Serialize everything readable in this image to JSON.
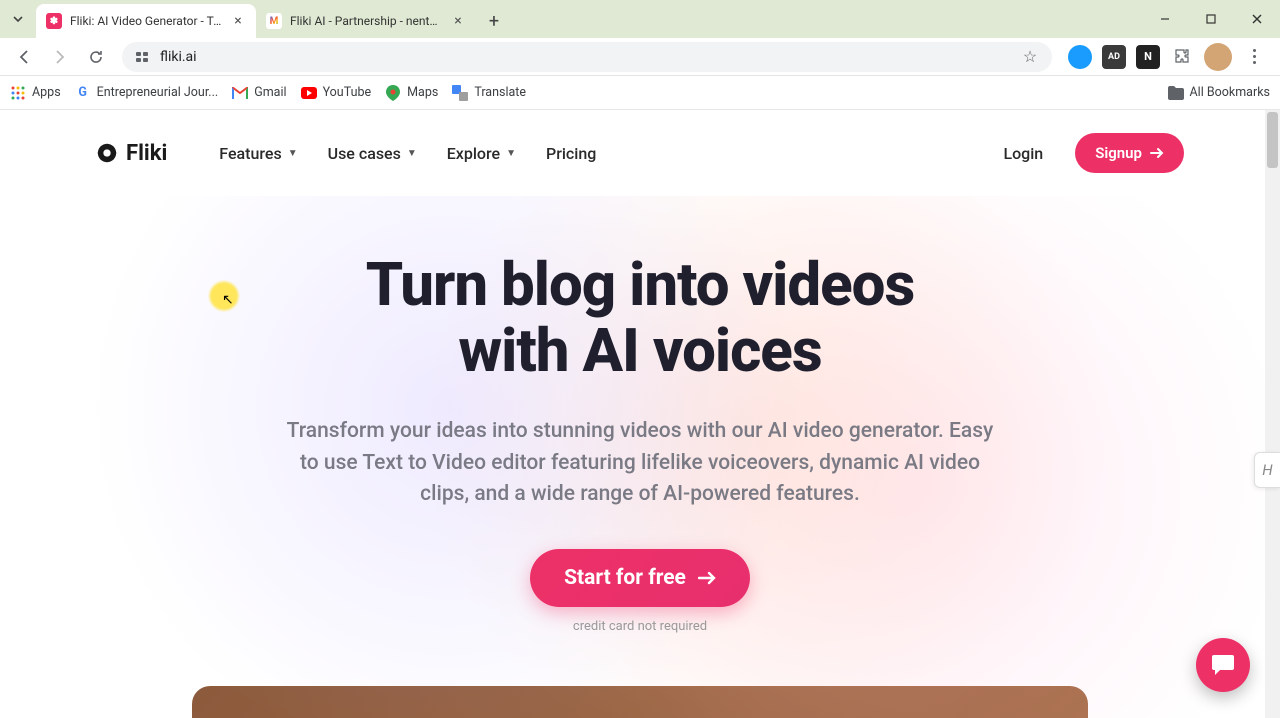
{
  "browser": {
    "tabs": [
      {
        "title": "Fliki: AI Video Generator - Turn",
        "active": true,
        "favicon_color": "#ed3167"
      },
      {
        "title": "Fliki AI - Partnership - nentelee",
        "active": false,
        "favicon_letter": "M"
      }
    ],
    "url": "fliki.ai"
  },
  "bookmarks": [
    {
      "label": "Apps",
      "icon": "apps"
    },
    {
      "label": "Entrepreneurial Jour...",
      "icon": "g"
    },
    {
      "label": "Gmail",
      "icon": "gmail"
    },
    {
      "label": "YouTube",
      "icon": "yt"
    },
    {
      "label": "Maps",
      "icon": "maps"
    },
    {
      "label": "Translate",
      "icon": "translate"
    },
    {
      "label": "All Bookmarks",
      "icon": "folder"
    }
  ],
  "site": {
    "brand": "Fliki",
    "nav": [
      {
        "label": "Features",
        "dropdown": true
      },
      {
        "label": "Use cases",
        "dropdown": true
      },
      {
        "label": "Explore",
        "dropdown": true
      },
      {
        "label": "Pricing",
        "dropdown": false
      }
    ],
    "login": "Login",
    "signup": "Signup"
  },
  "hero": {
    "heading_l1": "Turn blog into videos",
    "heading_l2": "with AI voices",
    "sub": "Transform your ideas into stunning videos with our AI video generator. Easy to use Text to Video editor featuring lifelike voiceovers, dynamic AI video clips, and a wide range of AI-powered features.",
    "cta": "Start for free",
    "cta_note": "credit card not required"
  }
}
